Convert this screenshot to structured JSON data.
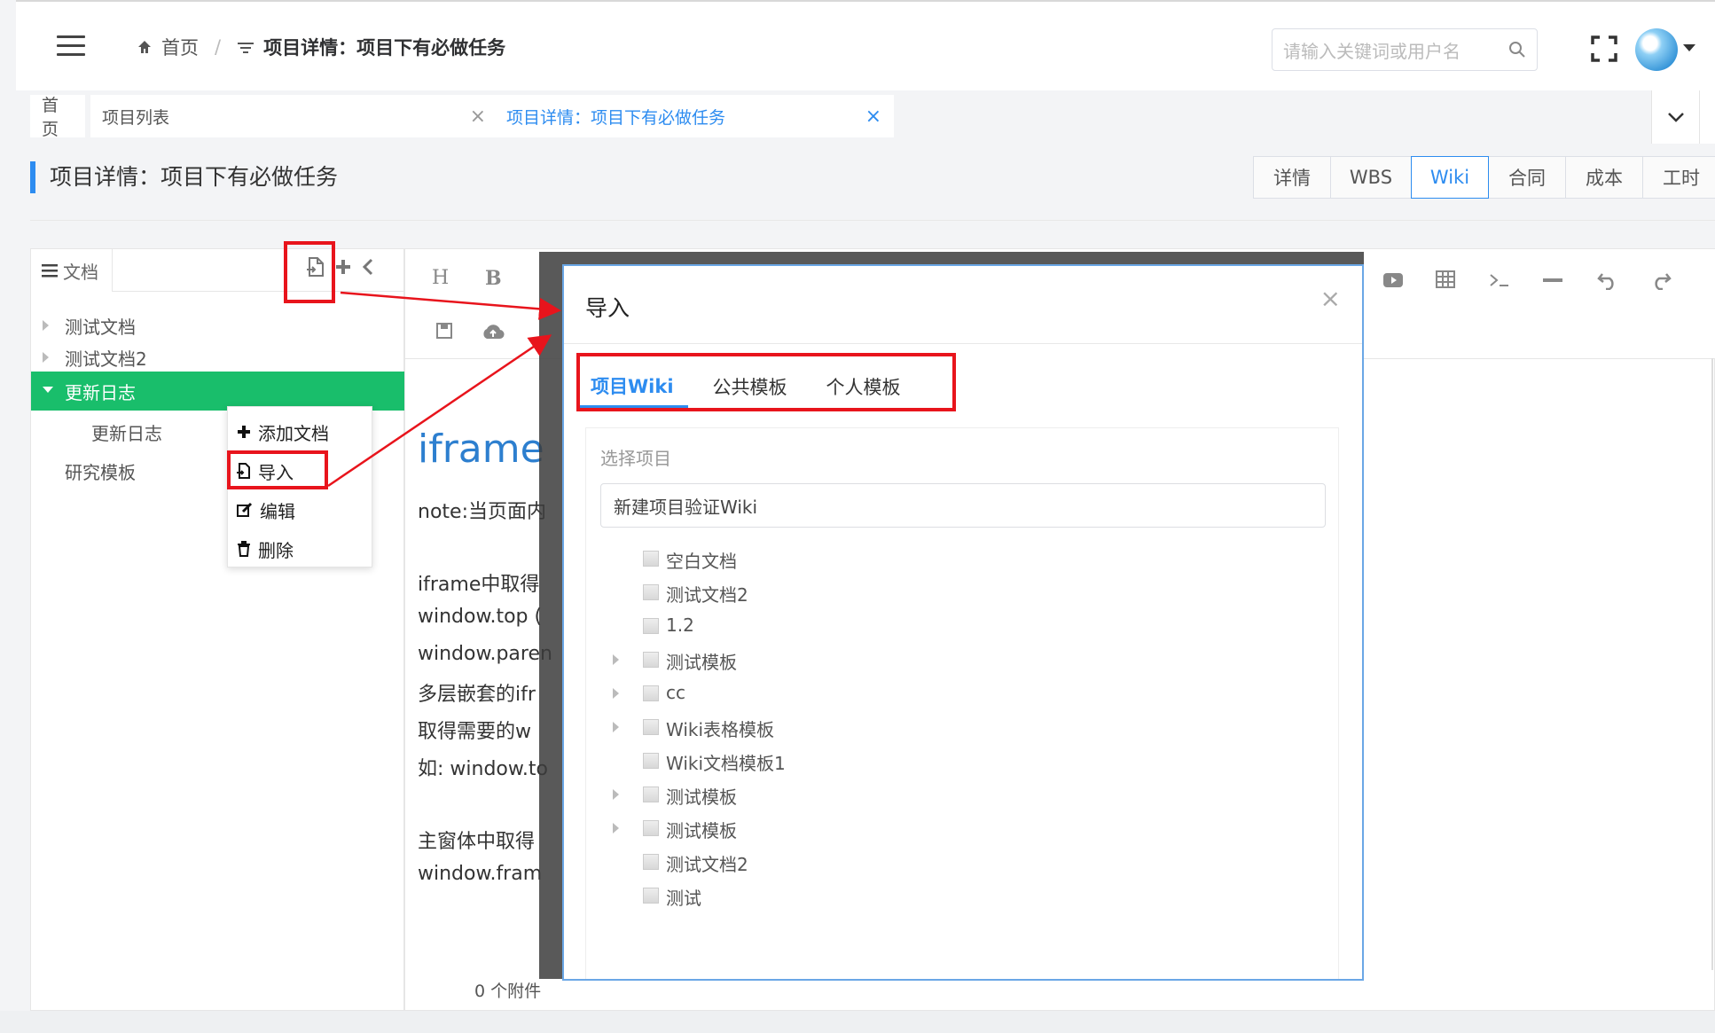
{
  "header": {
    "breadcrumb_home": "首页",
    "breadcrumb_sep": "/",
    "breadcrumb_current": "项目详情：项目下有必做任务",
    "search_placeholder": "请输入关键词或用户名"
  },
  "tags": [
    {
      "label": "首页"
    },
    {
      "label": "项目列表",
      "close": "×"
    },
    {
      "label": "项目详情：项目下有必做任务",
      "close": "×",
      "active": true
    }
  ],
  "page": {
    "title": "项目详情：项目下有必做任务",
    "tabs": [
      "详情",
      "WBS",
      "Wiki",
      "合同",
      "成本",
      "工时"
    ],
    "active_tab": "Wiki"
  },
  "docpanel": {
    "tab_label": "文档",
    "tree": [
      {
        "label": "测试文档",
        "arrow": true
      },
      {
        "label": "测试文档2",
        "arrow": true
      },
      {
        "label": "更新日志",
        "selected": true
      },
      {
        "label": "更新日志",
        "child": true
      },
      {
        "label": "研究模板"
      }
    ]
  },
  "context_menu": [
    "添加文档",
    "导入",
    "编辑",
    "删除"
  ],
  "editor": {
    "heading": "iframe",
    "lines": [
      "note:当页面内",
      "iframe中取得",
      "window.top (",
      "window.paren",
      "多层嵌套的ifr",
      "取得需要的w",
      "如: window.to",
      "主窗体中取得",
      "window.fram"
    ],
    "attachments": "0 个附件"
  },
  "modal": {
    "title": "导入",
    "close": "×",
    "tabs": [
      "项目Wiki",
      "公共模板",
      "个人模板"
    ],
    "active_tab": "项目Wiki",
    "select_label": "选择项目",
    "select_value": "新建项目验证Wiki",
    "tree": [
      {
        "label": "空白文档",
        "arrow": false
      },
      {
        "label": "测试文档2",
        "arrow": false
      },
      {
        "label": "1.2",
        "arrow": false
      },
      {
        "label": "测试模板",
        "arrow": true
      },
      {
        "label": "cc",
        "arrow": true
      },
      {
        "label": "Wiki表格模板",
        "arrow": true
      },
      {
        "label": "Wiki文档模板1",
        "arrow": false
      },
      {
        "label": "测试模板",
        "arrow": true
      },
      {
        "label": "测试模板",
        "arrow": true
      },
      {
        "label": "测试文档2",
        "arrow": false
      },
      {
        "label": "测试",
        "arrow": false
      }
    ]
  },
  "colors": {
    "accent": "#2d8cf0",
    "selected_green": "#19be6b",
    "annotation_red": "#e8141c"
  }
}
